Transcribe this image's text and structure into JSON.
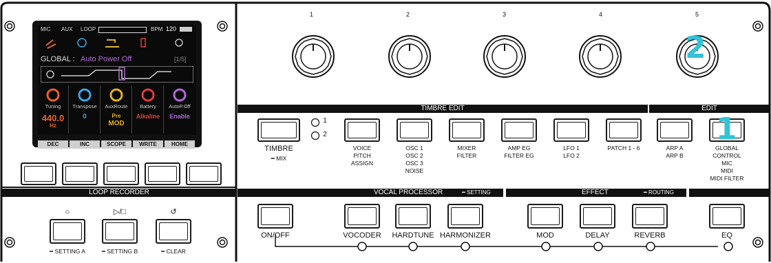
{
  "knob_numbers": [
    "1",
    "2",
    "3",
    "4",
    "5"
  ],
  "screen": {
    "status": {
      "mic": "MIC",
      "aux": "AUX",
      "loop": "LOOP",
      "bpm_label": "BPM",
      "bpm": "120"
    },
    "global_label": "GLOBAL : ",
    "global_value": "Auto Power Off",
    "page": "[1/5]",
    "params": [
      {
        "name": "Tuning",
        "value": "440.0",
        "unit": "Hz",
        "color": "#e8622a"
      },
      {
        "name": "Transpose",
        "value": "0",
        "unit": "",
        "color": "#3aa6e6"
      },
      {
        "name": "AuxRoute",
        "value": "Pre",
        "unit": "MOD",
        "color": "#e5b21c"
      },
      {
        "name": "Battery",
        "value": "Alkaline",
        "unit": "",
        "color": "#e23b3b"
      },
      {
        "name": "AutoP.Off",
        "value": "Enable",
        "unit": "",
        "color": "#b06ad8"
      }
    ],
    "fkeys": [
      "DEC",
      "INC",
      "SCOPE",
      "WRITE",
      "HOME"
    ]
  },
  "bars": {
    "loop_recorder": "LOOP RECORDER",
    "timbre_edit": "TIMBRE EDIT",
    "edit": "EDIT",
    "vocal_processor": "VOCAL PROCESSOR",
    "setting": "━ SETTING",
    "effect": "EFFECT",
    "routing": "━ ROUTING"
  },
  "timbre": {
    "label": "TIMBRE",
    "sub": "━ MIX",
    "one": "1",
    "two": "2"
  },
  "edit_buttons": [
    {
      "label": "VOICE\nPITCH\nASSIGN"
    },
    {
      "label": "OSC 1\nOSC 2\nOSC 3\nNOISE"
    },
    {
      "label": "MIXER\nFILTER"
    },
    {
      "label": "AMP EG\nFILTER EG"
    },
    {
      "label": "LFO 1\nLFO 2"
    },
    {
      "label": "PATCH 1 - 6"
    },
    {
      "label": "ARP A\nARP B"
    },
    {
      "label": "GLOBAL\nCONTROL\nMIC\nMIDI\nMIDI FILTER"
    }
  ],
  "loop_buttons": [
    {
      "symbol": "○",
      "sub": "━ SETTING A"
    },
    {
      "symbol": "▷/□",
      "sub": "━ SETTING B"
    },
    {
      "symbol": "↺",
      "sub": "━ CLEAR"
    }
  ],
  "bottom_buttons": [
    {
      "label": "ON/OFF"
    },
    {
      "label": "VOCODER"
    },
    {
      "label": "HARDTUNE"
    },
    {
      "label": "HARMONIZER"
    },
    {
      "label": "MOD"
    },
    {
      "label": "DELAY"
    },
    {
      "label": "REVERB"
    },
    {
      "label": "EQ"
    }
  ],
  "badges": {
    "one": "1",
    "two": "2"
  }
}
